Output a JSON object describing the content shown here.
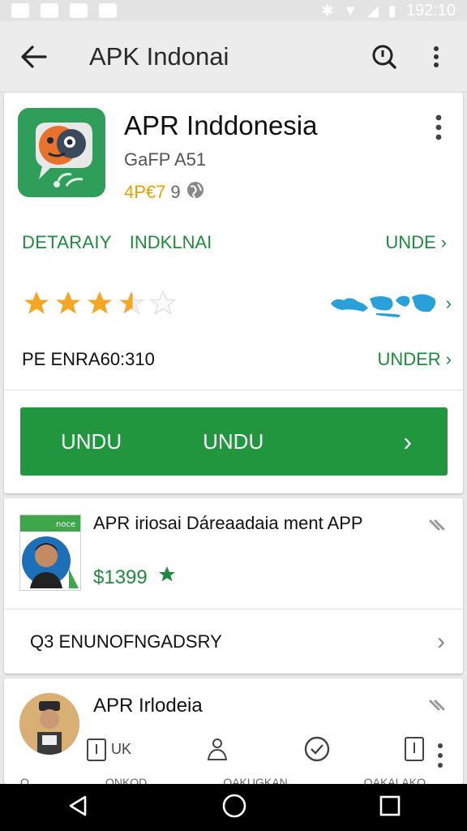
{
  "statusbar": {
    "time": "192:10"
  },
  "appbar": {
    "title": "APK Indonai"
  },
  "app": {
    "name": "APR Inddonesia",
    "developer": "GaFP A51",
    "meta_price": "4P€7",
    "meta_version": "9"
  },
  "details_row": {
    "left1": "DETARAIY",
    "left2": "INDKLNAI",
    "right": "UNDE"
  },
  "rating": {
    "value_stars": 3.5,
    "max_stars": 5
  },
  "pe_row": {
    "label": "PE ENRA60:310",
    "right": "UNDER"
  },
  "install_button": {
    "label1": "UNDU",
    "label2": "UNDU"
  },
  "card2": {
    "thumb_text": "noce",
    "title": "APR iriosai Dáreaadaia ment APP",
    "price": "$1399",
    "search_row_text": "Q3 ENUNOFNGADSRY"
  },
  "card3": {
    "title": "APR Irlodeia",
    "action1": "UK",
    "labels": [
      "Q",
      "ONKOD",
      "QAKUGKAN",
      "QAKALAKO"
    ]
  },
  "colors": {
    "accent": "#21963f",
    "star": "#f5a623",
    "map": "#2aa0d8"
  }
}
